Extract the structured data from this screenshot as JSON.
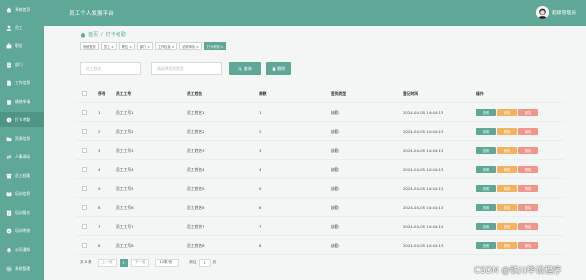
{
  "app": {
    "title": "员工个人发展平台",
    "user": "超级管理员"
  },
  "sidebar": {
    "items": [
      {
        "label": "系统首页",
        "icon": "home-icon"
      },
      {
        "label": "员工",
        "icon": "user-icon"
      },
      {
        "label": "职位",
        "icon": "briefcase-icon"
      },
      {
        "label": "部门",
        "icon": "building-icon"
      },
      {
        "label": "工作信息",
        "icon": "document-icon"
      },
      {
        "label": "绩效申请",
        "icon": "clipboard-icon"
      },
      {
        "label": "打卡考勤",
        "icon": "clock-icon"
      },
      {
        "label": "资源信息",
        "icon": "folder-icon"
      },
      {
        "label": "人事调动",
        "icon": "transfer-icon"
      },
      {
        "label": "员工档案",
        "icon": "archive-icon"
      },
      {
        "label": "培训信息",
        "icon": "book-icon"
      },
      {
        "label": "培训报名",
        "icon": "form-icon"
      },
      {
        "label": "培训考核",
        "icon": "check-icon"
      },
      {
        "label": "公司通知",
        "icon": "bell-icon"
      },
      {
        "label": "系统管理",
        "icon": "gear-icon"
      }
    ]
  },
  "breadcrumb": {
    "home": "首页",
    "current": "打卡考勤"
  },
  "tags": [
    {
      "label": "系统首页"
    },
    {
      "label": "员工 ×"
    },
    {
      "label": "职位 ×"
    },
    {
      "label": "部门 ×"
    },
    {
      "label": "工作信息 ×"
    },
    {
      "label": "绩效申请 ×"
    },
    {
      "label": "打卡考勤 ×"
    }
  ],
  "search": {
    "name_placeholder": "员工姓名",
    "type_placeholder": "请选择签到类型",
    "search_label": "查询",
    "delete_label": "删除"
  },
  "table": {
    "headers": {
      "index": "序号",
      "emp_no": "员工工号",
      "emp_name": "员工姓名",
      "week": "周数",
      "sign_type": "签到类型",
      "login_time": "登记时间",
      "actions": "操作"
    },
    "rows": [
      {
        "index": "1",
        "emp_no": "员工工号1",
        "emp_name": "员工姓名1",
        "week": "1",
        "sign_type": "缺勤",
        "login_time": "2024-04-05 14:44:13"
      },
      {
        "index": "2",
        "emp_no": "员工工号2",
        "emp_name": "员工姓名2",
        "week": "2",
        "sign_type": "缺勤",
        "login_time": "2024-04-05 14:44:13"
      },
      {
        "index": "3",
        "emp_no": "员工工号3",
        "emp_name": "员工姓名3",
        "week": "3",
        "sign_type": "缺勤",
        "login_time": "2024-04-05 14:44:13"
      },
      {
        "index": "4",
        "emp_no": "员工工号4",
        "emp_name": "员工姓名4",
        "week": "4",
        "sign_type": "缺勤",
        "login_time": "2024-04-05 14:44:13"
      },
      {
        "index": "5",
        "emp_no": "员工工号5",
        "emp_name": "员工姓名5",
        "week": "5",
        "sign_type": "缺勤",
        "login_time": "2024-04-05 14:44:13"
      },
      {
        "index": "6",
        "emp_no": "员工工号6",
        "emp_name": "员工姓名6",
        "week": "6",
        "sign_type": "缺勤",
        "login_time": "2024-04-05 14:44:13"
      },
      {
        "index": "7",
        "emp_no": "员工工号7",
        "emp_name": "员工姓名7",
        "week": "7",
        "sign_type": "缺勤",
        "login_time": "2024-04-05 14:44:13"
      },
      {
        "index": "8",
        "emp_no": "员工工号8",
        "emp_name": "员工姓名8",
        "week": "8",
        "sign_type": "缺勤",
        "login_time": "2024-04-05 14:44:13"
      }
    ],
    "actions": {
      "view": "查看",
      "edit": "修改",
      "del": "删除"
    }
  },
  "pager": {
    "total": "共 8 条",
    "prev": "上一页",
    "page": "1",
    "next": "下一页",
    "page_size": "10条/页",
    "goto_prefix": "前往",
    "goto_value": "1",
    "goto_suffix": "页"
  },
  "watermark": "CSDN @铁川毕设程序",
  "colors": {
    "accent": "#5fa796",
    "edit": "#f3b260",
    "delete": "#f19589"
  }
}
